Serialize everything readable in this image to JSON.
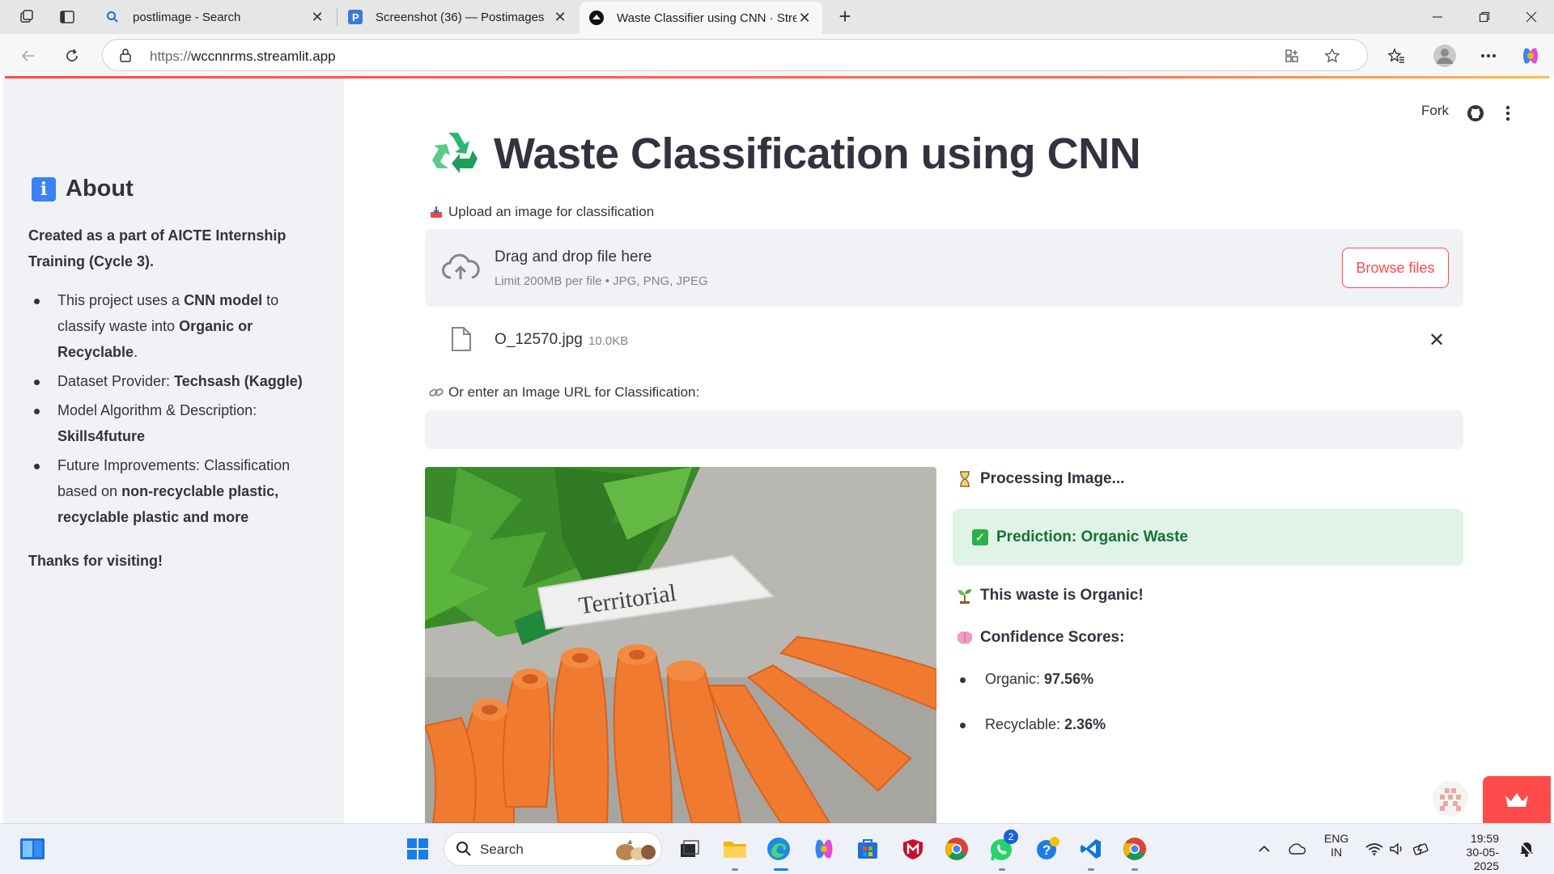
{
  "browser": {
    "tabs": [
      {
        "title": "postlimage - Search",
        "active": false
      },
      {
        "title": "Screenshot (36) — Postimages",
        "active": false
      },
      {
        "title": "Waste Classifier using CNN · Strea",
        "active": true
      }
    ],
    "url_protocol": "https://",
    "url_host": "wccnnrms.streamlit.app"
  },
  "sidebar": {
    "title": "About",
    "intro_bold": "Created as a part of AICTE Internship Training (Cycle 3).",
    "items": [
      {
        "pre": "This project uses a ",
        "b1": "CNN model",
        "mid": " to classify waste into ",
        "b2": "Organic or Recyclable",
        "post": "."
      },
      {
        "pre": "Dataset Provider: ",
        "b1": "Techsash (Kaggle)"
      },
      {
        "pre": "Model Algorithm & Description: ",
        "b1": "Skills4future"
      },
      {
        "pre": "Future Improvements: Classification based on ",
        "b1": "non-recyclable plastic, recyclable plastic and more"
      }
    ],
    "thanks": "Thanks for visiting!"
  },
  "header": {
    "fork_label": "Fork"
  },
  "main": {
    "title": "Waste Classification using CNN",
    "upload_label": "Upload an image for classification",
    "dropzone": {
      "main": "Drag and drop file here",
      "sub": "Limit 200MB per file • JPG, PNG, JPEG",
      "browse_label": "Browse files"
    },
    "file": {
      "name": "O_12570.jpg",
      "size": "10.0KB"
    },
    "url_label": "Or enter an Image URL for Classification:",
    "url_value": "",
    "processing": "Processing Image...",
    "prediction": "Prediction: Organic Waste",
    "organic_msg": "This waste is Organic!",
    "confidence_title": "Confidence Scores:",
    "scores": [
      {
        "label": "Organic: ",
        "value": "97.56%"
      },
      {
        "label": "Recyclable: ",
        "value": "2.36%"
      }
    ],
    "image_knife_text": "Territorial"
  },
  "taskbar": {
    "search_label": "Search",
    "lang_top": "ENG",
    "lang_bottom": "IN",
    "time": "19:59",
    "date": "30-05-2025",
    "whatsapp_badge": "2"
  },
  "colors": {
    "accent": "#ff4b4b",
    "sidebar_bg": "#f0f2f6",
    "success_bg": "#dff3e7",
    "success_text": "#177233"
  }
}
